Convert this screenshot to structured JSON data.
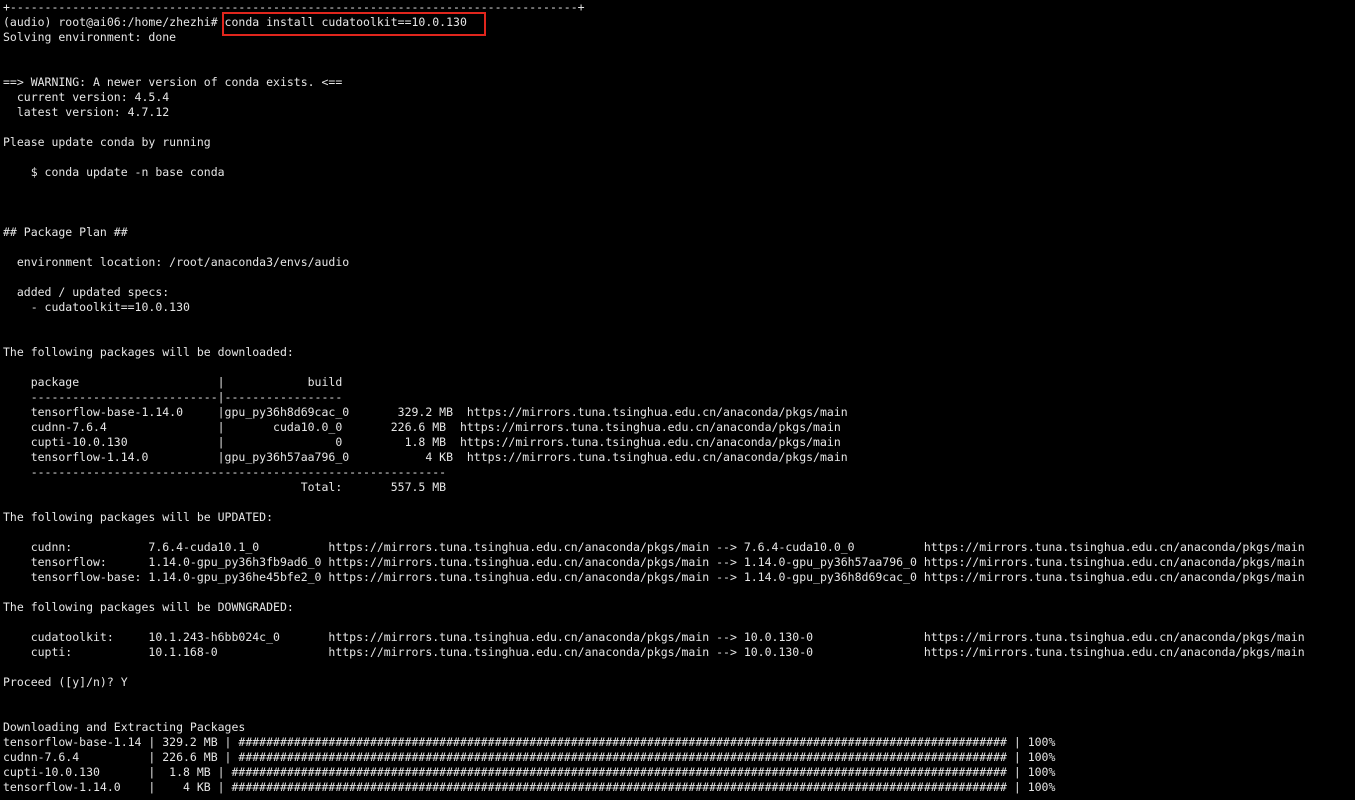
{
  "terminal": {
    "lines": [
      "+----------------------------------------------------------------------------------+",
      "(audio) root@ai06:/home/zhezhi# conda install cudatoolkit==10.0.130",
      "Solving environment: done",
      "",
      "",
      "==> WARNING: A newer version of conda exists. <==",
      "  current version: 4.5.4",
      "  latest version: 4.7.12",
      "",
      "Please update conda by running",
      "",
      "    $ conda update -n base conda",
      "",
      "",
      "",
      "## Package Plan ##",
      "",
      "  environment location: /root/anaconda3/envs/audio",
      "",
      "  added / updated specs:",
      "    - cudatoolkit==10.0.130",
      "",
      "",
      "The following packages will be downloaded:",
      "",
      "    package                    |            build",
      "    ---------------------------|-----------------",
      "    tensorflow-base-1.14.0     |gpu_py36h8d69cac_0       329.2 MB  https://mirrors.tuna.tsinghua.edu.cn/anaconda/pkgs/main",
      "    cudnn-7.6.4                |       cuda10.0_0       226.6 MB  https://mirrors.tuna.tsinghua.edu.cn/anaconda/pkgs/main",
      "    cupti-10.0.130             |                0         1.8 MB  https://mirrors.tuna.tsinghua.edu.cn/anaconda/pkgs/main",
      "    tensorflow-1.14.0          |gpu_py36h57aa796_0           4 KB  https://mirrors.tuna.tsinghua.edu.cn/anaconda/pkgs/main",
      "    ------------------------------------------------------------",
      "                                           Total:       557.5 MB",
      "",
      "The following packages will be UPDATED:",
      "",
      "    cudnn:           7.6.4-cuda10.1_0          https://mirrors.tuna.tsinghua.edu.cn/anaconda/pkgs/main --> 7.6.4-cuda10.0_0          https://mirrors.tuna.tsinghua.edu.cn/anaconda/pkgs/main",
      "    tensorflow:      1.14.0-gpu_py36h3fb9ad6_0 https://mirrors.tuna.tsinghua.edu.cn/anaconda/pkgs/main --> 1.14.0-gpu_py36h57aa796_0 https://mirrors.tuna.tsinghua.edu.cn/anaconda/pkgs/main",
      "    tensorflow-base: 1.14.0-gpu_py36he45bfe2_0 https://mirrors.tuna.tsinghua.edu.cn/anaconda/pkgs/main --> 1.14.0-gpu_py36h8d69cac_0 https://mirrors.tuna.tsinghua.edu.cn/anaconda/pkgs/main",
      "",
      "The following packages will be DOWNGRADED:",
      "",
      "    cudatoolkit:     10.1.243-h6bb024c_0       https://mirrors.tuna.tsinghua.edu.cn/anaconda/pkgs/main --> 10.0.130-0                https://mirrors.tuna.tsinghua.edu.cn/anaconda/pkgs/main",
      "    cupti:           10.1.168-0                https://mirrors.tuna.tsinghua.edu.cn/anaconda/pkgs/main --> 10.0.130-0                https://mirrors.tuna.tsinghua.edu.cn/anaconda/pkgs/main",
      "",
      "Proceed ([y]/n)? Y",
      "",
      "",
      "Downloading and Extracting Packages",
      "tensorflow-base-1.14 | 329.2 MB | ############################################################################################################### | 100%",
      "cudnn-7.6.4          | 226.6 MB | ############################################################################################################### | 100%",
      "cupti-10.0.130       |  1.8 MB | ################################################################################################################ | 100%",
      "tensorflow-1.14.0    |    4 KB | ################################################################################################################ | 100%"
    ]
  }
}
